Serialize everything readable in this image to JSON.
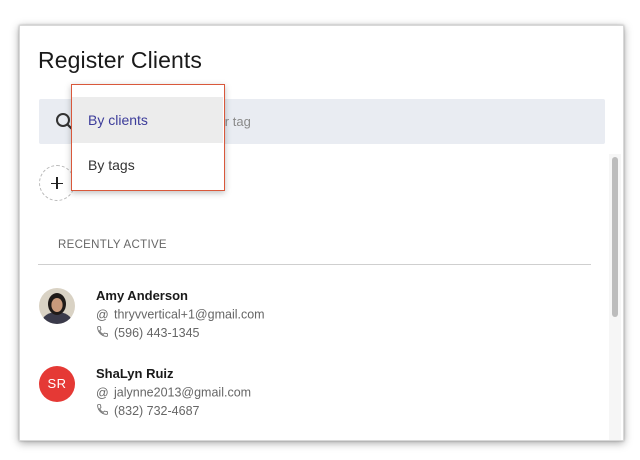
{
  "dialog": {
    "title": "Register Clients"
  },
  "search": {
    "placeholder": "Search by name, email or tag",
    "value": ""
  },
  "search_mode_menu": {
    "options": [
      {
        "label": "By clients",
        "selected": true
      },
      {
        "label": "By tags",
        "selected": false
      }
    ]
  },
  "section": {
    "recently_active_label": "RECENTLY ACTIVE"
  },
  "clients": [
    {
      "name": "Amy Anderson",
      "email": "thryvvertical+1@gmail.com",
      "phone": "(596) 443-1345",
      "avatar_type": "photo",
      "initials": ""
    },
    {
      "name": "ShaLyn Ruiz",
      "email": "jalynne2013@gmail.com",
      "phone": "(832) 732-4687",
      "avatar_type": "initials",
      "initials": "SR"
    }
  ],
  "icons": {
    "email": "at-icon",
    "phone": "phone-icon",
    "search": "search-icon",
    "add": "plus-icon"
  },
  "colors": {
    "accent_border": "#d9583b",
    "selected_text": "#3c3c9a",
    "initials_avatar_bg": "#e53935",
    "search_bg": "#e9ecf2"
  }
}
